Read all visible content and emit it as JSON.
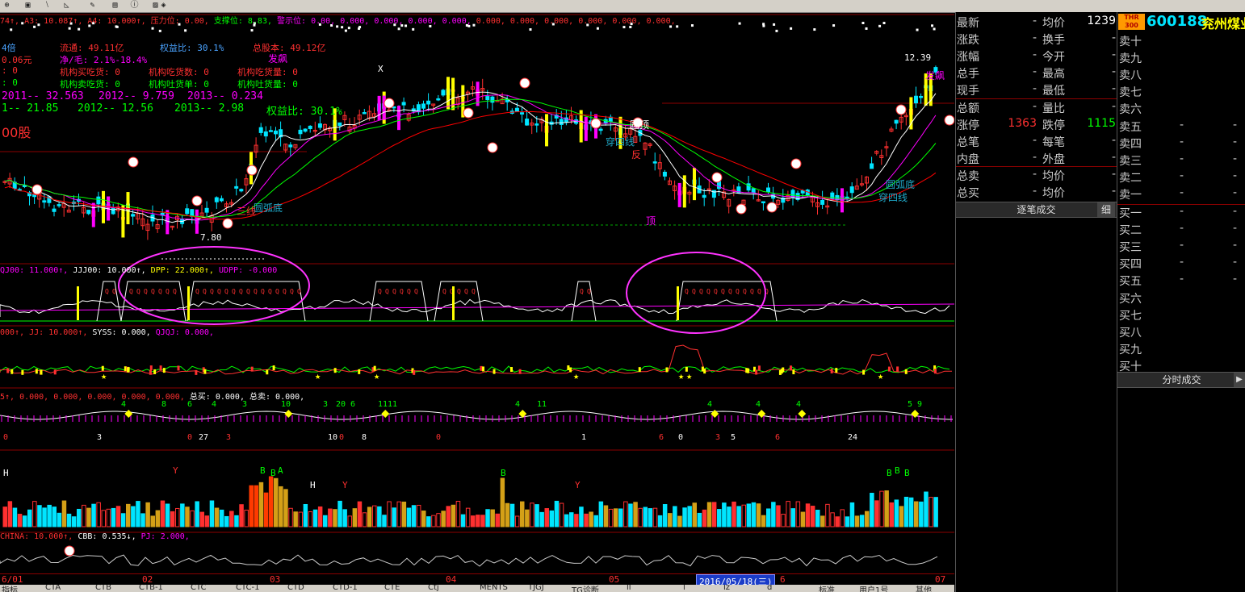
{
  "toolbar": {
    "icons": [
      "zoom-icon",
      "chart-icon",
      "line-icon",
      "draw-icon",
      "tool-icon",
      "doc-icon",
      "info-icon",
      "image-icon",
      "help-icon"
    ]
  },
  "main_header": {
    "p1": "74↑, A3: 10.087↑, A4: 10.000↑,",
    "p2": "压力位: 0.00,",
    "p3": "支撑位: 8.83,",
    "p4": "警示位: 0.00, 0.000, 0.000, 0.000, 0.000,",
    "p5": "0.000, 0.000, 0.000, 0.000, 0.000, 0.000,"
  },
  "fundamentals": {
    "r1a": "4倍",
    "r1b": "流通: 49.11亿",
    "r1c": "权益比: 30.1%",
    "r1d": "总股本: 49.12亿",
    "r2a": "0.06元",
    "r2b": "净/毛: 2.1%-18.4%",
    "r2c": "发飙",
    "r3a": ": 0",
    "r3b": "机构买吃货: 0",
    "r3c": "机构吃货数: 0",
    "r3d": "机构吃货量: 0",
    "r4a": ": 0",
    "r4b": "机构卖吃货: 0",
    "r4c": "机构吐货单: 0",
    "r4d": "机构吐货量: 0",
    "r5a": "2011-- 32.563",
    "r5b": "2012-- 9.759",
    "r5c": "2013-- 0.234",
    "r6a": "1-- 21.85",
    "r6b": "2012-- 12.56",
    "r6c": "2013-- 2.98",
    "r6d": "权益比: 30.1%",
    "r7": "00股"
  },
  "annotations": {
    "top_price": "12.39",
    "fa_biao": "发飙",
    "x_mark": "X",
    "support": "7.80",
    "yuanhudi": "圆弧底",
    "sanxian": "三线",
    "chuansixian": "穿四线",
    "yuanhudi2": "圆弧底",
    "chuansixian2": "穿四线",
    "yuandi": "圆顶",
    "fan": "反",
    "ding": "顶"
  },
  "ind1": {
    "p1": "QJ00: 11.000↑,",
    "p2": "JJJ00: 10.000↑,",
    "p3": "DPP: 22.000↑,",
    "p4": "UDPP: -0.000"
  },
  "ind2": {
    "p1": "000↑,",
    "p2": "JJ: 10.000↑,",
    "p3": "SYSS: 0.000,",
    "p4": "QJQJ: 0.000,"
  },
  "ind3": {
    "p1": "5↑, 0.000, 0.000, 0.000, 0.000, 0.000,",
    "p2": "总买: 0.000,",
    "p3": "总卖: 0.000,"
  },
  "ind5": {
    "p1": "CHINA: 10.000↑,",
    "p2": "CBB: 0.535↓,",
    "p3": "PJ: 2.000,"
  },
  "ind3_numbers": [
    "4",
    "8",
    "6",
    "4",
    "3",
    "10",
    "3",
    "20",
    "6",
    "1111",
    "4",
    "11",
    "4",
    "4",
    "4",
    "5",
    "9"
  ],
  "ind3_bottom": [
    "0",
    "3",
    "0",
    "27",
    "3",
    "10",
    "0",
    "8",
    "0",
    "1",
    "6",
    "0",
    "3",
    "5",
    "6",
    "24"
  ],
  "vol_labels": [
    "B",
    "B",
    "A",
    "H",
    "Y",
    "B",
    "Y",
    "B",
    "B",
    "B",
    "Y",
    "H"
  ],
  "quote": {
    "rows": [
      {
        "l1": "最新",
        "v1": "-",
        "l2": "均价",
        "v2": "1239"
      },
      {
        "l1": "涨跌",
        "v1": "-",
        "l2": "换手",
        "v2": "-"
      },
      {
        "l1": "涨幅",
        "v1": "-",
        "l2": "今开",
        "v2": "-"
      },
      {
        "l1": "总手",
        "v1": "-",
        "l2": "最高",
        "v2": "-"
      },
      {
        "l1": "现手",
        "v1": "-",
        "l2": "最低",
        "v2": "-"
      },
      {
        "l1": "总额",
        "v1": "-",
        "l2": "量比",
        "v2": "-"
      },
      {
        "l1": "涨停",
        "v1": "1363",
        "l2": "跌停",
        "v2": "1115"
      },
      {
        "l1": "总笔",
        "v1": "-",
        "l2": "每笔",
        "v2": "-"
      },
      {
        "l1": "内盘",
        "v1": "-",
        "l2": "外盘",
        "v2": "-"
      },
      {
        "l1": "总卖",
        "v1": "-",
        "l2": "均价",
        "v2": "-"
      },
      {
        "l1": "总买",
        "v1": "-",
        "l2": "均价",
        "v2": "-"
      }
    ],
    "trades_btn": "逐笔成交",
    "detail_btn": "细"
  },
  "stock": {
    "badge_top": "THR",
    "badge_bottom": "300",
    "code": "600188",
    "name": "兖州煤业"
  },
  "orderbook": {
    "sell": [
      {
        "label": "卖十",
        "price": "",
        "vol": ""
      },
      {
        "label": "卖九",
        "price": "",
        "vol": ""
      },
      {
        "label": "卖八",
        "price": "",
        "vol": ""
      },
      {
        "label": "卖七",
        "price": "",
        "vol": ""
      },
      {
        "label": "卖六",
        "price": "",
        "vol": ""
      },
      {
        "label": "卖五",
        "price": "-",
        "vol": "-"
      },
      {
        "label": "卖四",
        "price": "-",
        "vol": "-"
      },
      {
        "label": "卖三",
        "price": "-",
        "vol": "-"
      },
      {
        "label": "卖二",
        "price": "-",
        "vol": "-"
      },
      {
        "label": "卖一",
        "price": "-",
        "vol": "-"
      }
    ],
    "buy": [
      {
        "label": "买一",
        "price": "-",
        "vol": "-"
      },
      {
        "label": "买二",
        "price": "-",
        "vol": "-"
      },
      {
        "label": "买三",
        "price": "-",
        "vol": "-"
      },
      {
        "label": "买四",
        "price": "-",
        "vol": "-"
      },
      {
        "label": "买五",
        "price": "-",
        "vol": "-"
      },
      {
        "label": "买六",
        "price": "",
        "vol": ""
      },
      {
        "label": "买七",
        "price": "",
        "vol": ""
      },
      {
        "label": "买八",
        "price": "",
        "vol": ""
      },
      {
        "label": "买九",
        "price": "",
        "vol": ""
      },
      {
        "label": "买十",
        "price": "",
        "vol": ""
      }
    ],
    "timeshare_btn": "分时成交"
  },
  "date_axis": {
    "months": [
      "6/01",
      "02",
      "03",
      "04",
      "05",
      "6",
      "07"
    ],
    "cursor_date": "2016/05/18(三)"
  },
  "tabs": [
    "指标",
    "CTA",
    "CTB",
    "CTB-1",
    "CTC",
    "CTC-1",
    "CTD",
    "CTD-1",
    "CTE",
    "Ctj",
    "MENTS",
    "TJGJ",
    "TG诊断",
    "ll",
    "l",
    "lz",
    "d",
    "标准",
    "用户1号",
    "其他"
  ],
  "colors": {
    "up": "#ff3030",
    "down": "#00e5ff",
    "ma_white": "#ffffff",
    "ma_yellow": "#ffff00",
    "ma_magenta": "#ff00ff",
    "ma_green": "#00ff00",
    "ma_red": "#ff0000",
    "highlight_ellipse": "#ff33ff"
  }
}
